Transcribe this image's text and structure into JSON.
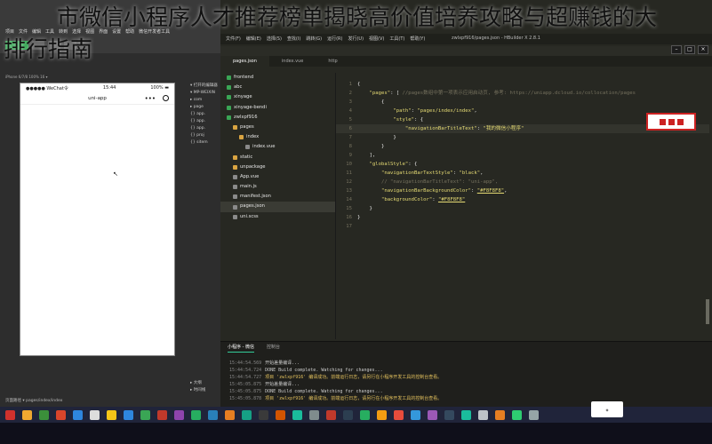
{
  "headline": {
    "line1": "市微信小程序人才推荐榜单揭晓高价值培养攻略与超赚钱的大",
    "line2": "排行指南"
  },
  "devtools": {
    "menu": [
      "项目",
      "文件",
      "编辑",
      "工具",
      "转到",
      "选择",
      "视图",
      "界面",
      "设置",
      "帮助",
      "微信开发者工具"
    ],
    "device_label": "iPhone 6/7/8 100% 16 ▾",
    "status_bar": {
      "carrier": "●●●●● WeChat令",
      "time": "15:44",
      "battery": "100% ▬"
    },
    "nav_title": "uni-app",
    "tree": [
      "▾ 打开的编辑器",
      "▾ MP-WEIXIN",
      "▸ com",
      "▸ page",
      "{} app.",
      "{} app.",
      "{} app.",
      "{} proj",
      "{} sitem"
    ],
    "bottom_tree": [
      "▸ 大纲",
      "▸ 时间线"
    ],
    "page_path": "页面路径 ▾  pages/index/index"
  },
  "hbuilder": {
    "title": "zwlxpf916/pages.json - HBuilder X 2.8.1",
    "menu": [
      "文件(F)",
      "编辑(E)",
      "选择(S)",
      "查找(I)",
      "跳转(G)",
      "运行(R)",
      "发行(U)",
      "视图(V)",
      "工具(T)",
      "帮助(Y)"
    ],
    "tabs": [
      "pages.json",
      "index.vue",
      "http"
    ],
    "active_tab": "pages.json",
    "tree": [
      {
        "label": "frontend",
        "type": "proj",
        "indent": 1
      },
      {
        "label": "abc",
        "type": "proj",
        "indent": 1
      },
      {
        "label": "xinyage",
        "type": "proj",
        "indent": 1
      },
      {
        "label": "xinyage-bendi",
        "type": "proj",
        "indent": 1
      },
      {
        "label": "zwlxpf916",
        "type": "proj",
        "indent": 1
      },
      {
        "label": "pages",
        "type": "folder",
        "indent": 2
      },
      {
        "label": "index",
        "type": "folder",
        "indent": 3
      },
      {
        "label": "index.vue",
        "type": "file",
        "indent": 4
      },
      {
        "label": "static",
        "type": "folder",
        "indent": 2
      },
      {
        "label": "unpackage",
        "type": "folder",
        "indent": 2
      },
      {
        "label": "App.vue",
        "type": "file",
        "indent": 2
      },
      {
        "label": "main.js",
        "type": "file",
        "indent": 2
      },
      {
        "label": "manifest.json",
        "type": "file",
        "indent": 2
      },
      {
        "label": "pages.json",
        "type": "file",
        "indent": 2,
        "selected": true
      },
      {
        "label": "uni.scss",
        "type": "file",
        "indent": 2
      }
    ],
    "code": [
      {
        "n": "1",
        "t": "{"
      },
      {
        "n": "2",
        "t": "    \"pages\": [ //pages数组中第一项表示应用启动页, 参考: https://uniapp.dcloud.io/collocation/pages"
      },
      {
        "n": "3",
        "t": "        {"
      },
      {
        "n": "4",
        "t": "            \"path\": \"pages/index/index\","
      },
      {
        "n": "5",
        "t": "            \"style\": {"
      },
      {
        "n": "6",
        "t": "                \"navigationBarTitleText\": \"我的微信小程序\""
      },
      {
        "n": "7",
        "t": "            }"
      },
      {
        "n": "8",
        "t": "        }"
      },
      {
        "n": "9",
        "t": "    ],"
      },
      {
        "n": "10",
        "t": "    \"globalStyle\": {"
      },
      {
        "n": "11",
        "t": "        \"navigationBarTextStyle\": \"black\","
      },
      {
        "n": "12",
        "t": "        // \"navigationBarTitleText\": \"uni-app\","
      },
      {
        "n": "13",
        "t": "        \"navigationBarBackgroundColor\": \"#F8F8F8\","
      },
      {
        "n": "14",
        "t": "        \"backgroundColor\": \"#F8F8F8\""
      },
      {
        "n": "15",
        "t": "    }"
      },
      {
        "n": "16",
        "t": "}"
      },
      {
        "n": "17",
        "t": ""
      }
    ],
    "console_tabs": [
      "小程序 - 微信",
      "控制台"
    ],
    "console": [
      {
        "ts": "15:44:54.569",
        "msg": "开始差量编译...",
        "ok": false
      },
      {
        "ts": "15:44:54.724",
        "msg": "DONE  Build complete. Watching for changes...",
        "ok": false
      },
      {
        "ts": "15:44:54.727",
        "msg": "项目 'zwlxpf916' 编译成功。前端运行日志，请另行在小程序开发工具的控制台查看。",
        "ok": true
      },
      {
        "ts": "15:45:05.875",
        "msg": "开始差量编译...",
        "ok": false
      },
      {
        "ts": "15:45:05.875",
        "msg": "DONE  Build complete. Watching for changes...",
        "ok": false
      },
      {
        "ts": "15:45:05.878",
        "msg": "项目 'zwlxpf916' 编译成功。前端运行日志，请另行在小程序开发工具的控制台查看。",
        "ok": true
      }
    ]
  },
  "taskbar": {
    "icon_colors": [
      "#f0a830",
      "#3b8f3a",
      "#d9452b",
      "#2e86de",
      "#dddddd",
      "#f5c518",
      "#2e86de",
      "#3aa655",
      "#c0392b",
      "#8e44ad",
      "#27ae60",
      "#2980b9",
      "#e67e22",
      "#16a085",
      "#3a3a3a",
      "#d35400",
      "#1abc9c",
      "#7f8c8d",
      "#c0392b",
      "#2c3e50",
      "#27ae60",
      "#f39c12",
      "#e74c3c",
      "#3498db",
      "#9b59b6",
      "#34495e",
      "#1abc9c",
      "#bdc3c7",
      "#e67e22",
      "#2ecc71",
      "#95a5a6"
    ]
  }
}
